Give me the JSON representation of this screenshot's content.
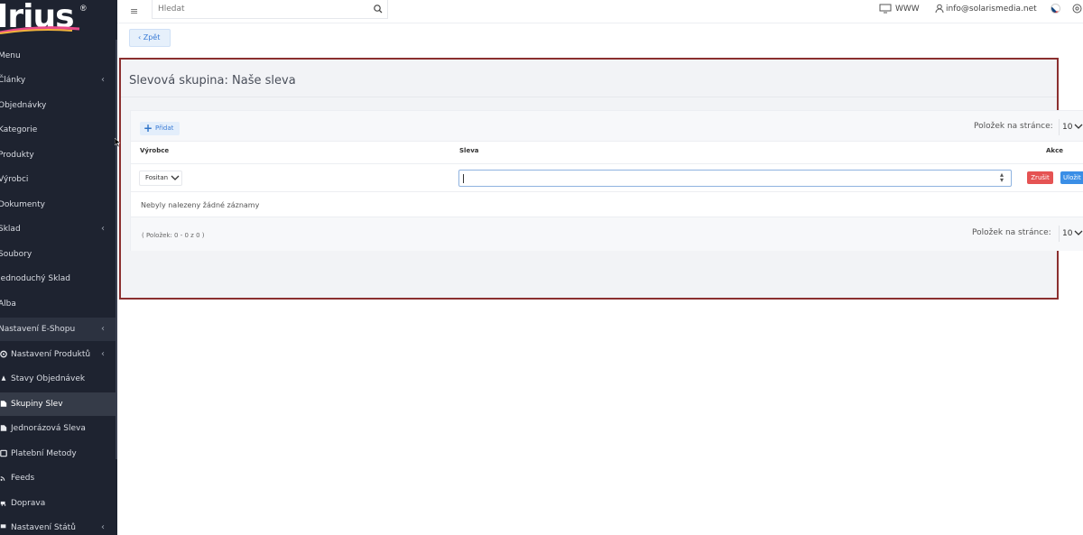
{
  "app": {
    "logo_text": "Irius",
    "logo_mark": "®",
    "brand_colors": {
      "sidebar_bg": "#1e2330",
      "accent": "#3a8ee6",
      "danger": "#e55353",
      "panel_border": "#8b2f2f"
    }
  },
  "topbar": {
    "menu_icon": "hamburger-icon",
    "search_placeholder": "Hledat",
    "www_label": "WWW",
    "user_email": "info@solarismedia.net"
  },
  "sidebar": {
    "items": [
      {
        "label": "Menu"
      },
      {
        "label": "Články",
        "chevron": "‹"
      },
      {
        "label": "Objednávky"
      },
      {
        "label": "Kategorie"
      },
      {
        "label": "Produkty"
      },
      {
        "label": "Výrobci"
      },
      {
        "label": "Dokumenty"
      },
      {
        "label": "Sklad",
        "chevron": "‹"
      },
      {
        "label": "Soubory"
      },
      {
        "label": "Jednoduchý Sklad"
      },
      {
        "label": "Alba"
      },
      {
        "label": "Nastavení E-Shopu",
        "chevron": "‹"
      },
      {
        "label": "Nastavení Produktů",
        "chevron": "‹"
      },
      {
        "label": "Stavy Objednávek"
      },
      {
        "label": "Skupiny Slev"
      },
      {
        "label": "Jednorázová Sleva"
      },
      {
        "label": "Platební Metody"
      },
      {
        "label": "Feeds"
      },
      {
        "label": "Doprava"
      },
      {
        "label": "Nastavení Států",
        "chevron": "‹"
      }
    ]
  },
  "page": {
    "back_label": "‹ Zpět",
    "title": "Slevová skupina: Naše sleva"
  },
  "table": {
    "add_label": "Přidat",
    "per_page_label": "Položek na stránce:",
    "per_page_value": "10",
    "columns": {
      "maker": "Výrobce",
      "discount": "Sleva",
      "actions": "Akce"
    },
    "edit_row": {
      "maker_value": "Fositan",
      "discount_value": "",
      "cancel_label": "Zrušit",
      "save_label": "Uložit"
    },
    "empty_message": "Nebyly nalezeny žádné záznamy",
    "count_info": "( Položek: 0 - 0 z 0 )"
  }
}
